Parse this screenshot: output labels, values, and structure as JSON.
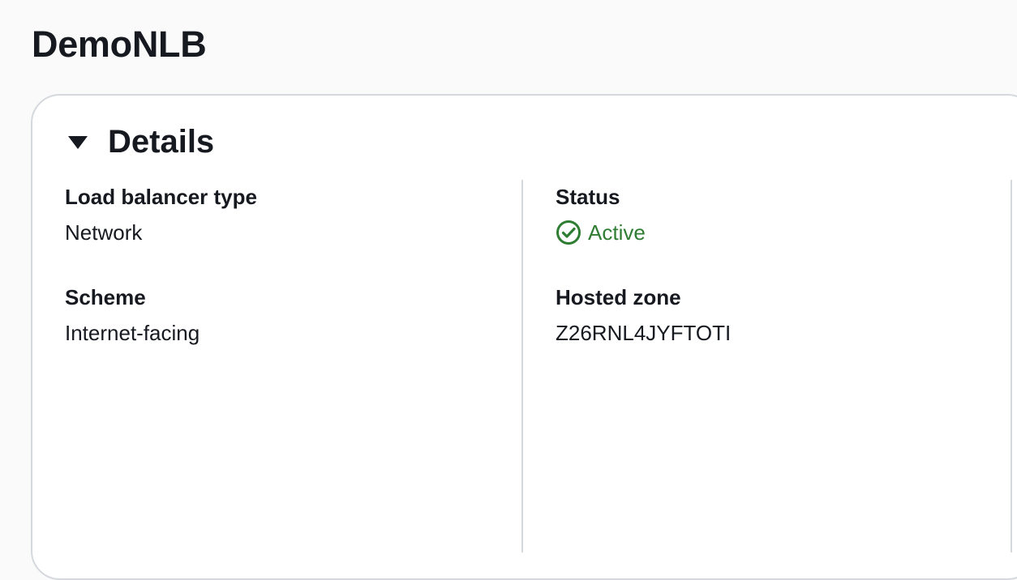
{
  "page": {
    "title": "DemoNLB"
  },
  "details": {
    "section_title": "Details",
    "expanded": true,
    "caret_icon": "caret-down-icon",
    "colors": {
      "panel_background": "#ffffff",
      "page_background": "#fafafa",
      "border": "#d5d9dd",
      "text": "#16191f",
      "success": "#2f7d32"
    },
    "fields": {
      "load_balancer_type": {
        "label": "Load balancer type",
        "value": "Network"
      },
      "scheme": {
        "label": "Scheme",
        "value": "Internet-facing"
      },
      "status": {
        "label": "Status",
        "value": "Active",
        "icon": "success-check-icon"
      },
      "hosted_zone": {
        "label": "Hosted zone",
        "value": "Z26RNL4JYFTOTI"
      }
    }
  }
}
